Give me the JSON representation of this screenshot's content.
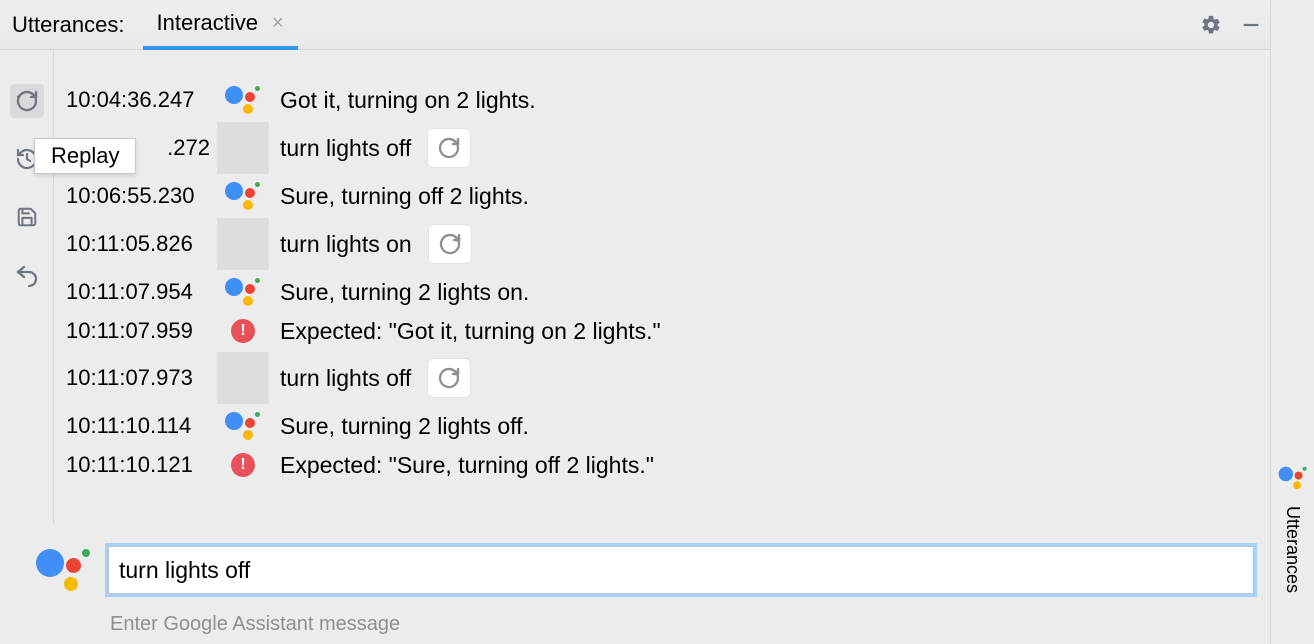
{
  "header": {
    "label": "Utterances:",
    "tab_label": "Interactive"
  },
  "tooltip": {
    "replay": "Replay"
  },
  "log": [
    {
      "ts": "10:04:36.247",
      "kind": "assistant",
      "text": "Got it, turning on 2 lights."
    },
    {
      "ts": ".272",
      "kind": "user",
      "text": "turn lights off",
      "ts_partial": true
    },
    {
      "ts": "10:06:55.230",
      "kind": "assistant",
      "text": "Sure, turning off 2 lights."
    },
    {
      "ts": "10:11:05.826",
      "kind": "user",
      "text": "turn lights on"
    },
    {
      "ts": "10:11:07.954",
      "kind": "assistant",
      "text": "Sure, turning 2 lights on."
    },
    {
      "ts": "10:11:07.959",
      "kind": "error",
      "text": "Expected: \"Got it, turning on 2 lights.\""
    },
    {
      "ts": "10:11:07.973",
      "kind": "user",
      "text": "turn lights off"
    },
    {
      "ts": "10:11:10.114",
      "kind": "assistant",
      "text": "Sure, turning 2 lights off."
    },
    {
      "ts": "10:11:10.121",
      "kind": "error",
      "text": "Expected: \"Sure, turning off 2 lights.\""
    }
  ],
  "input": {
    "value": "turn lights off",
    "hint": "Enter Google Assistant message"
  },
  "side_tab": {
    "label": "Utterances"
  }
}
